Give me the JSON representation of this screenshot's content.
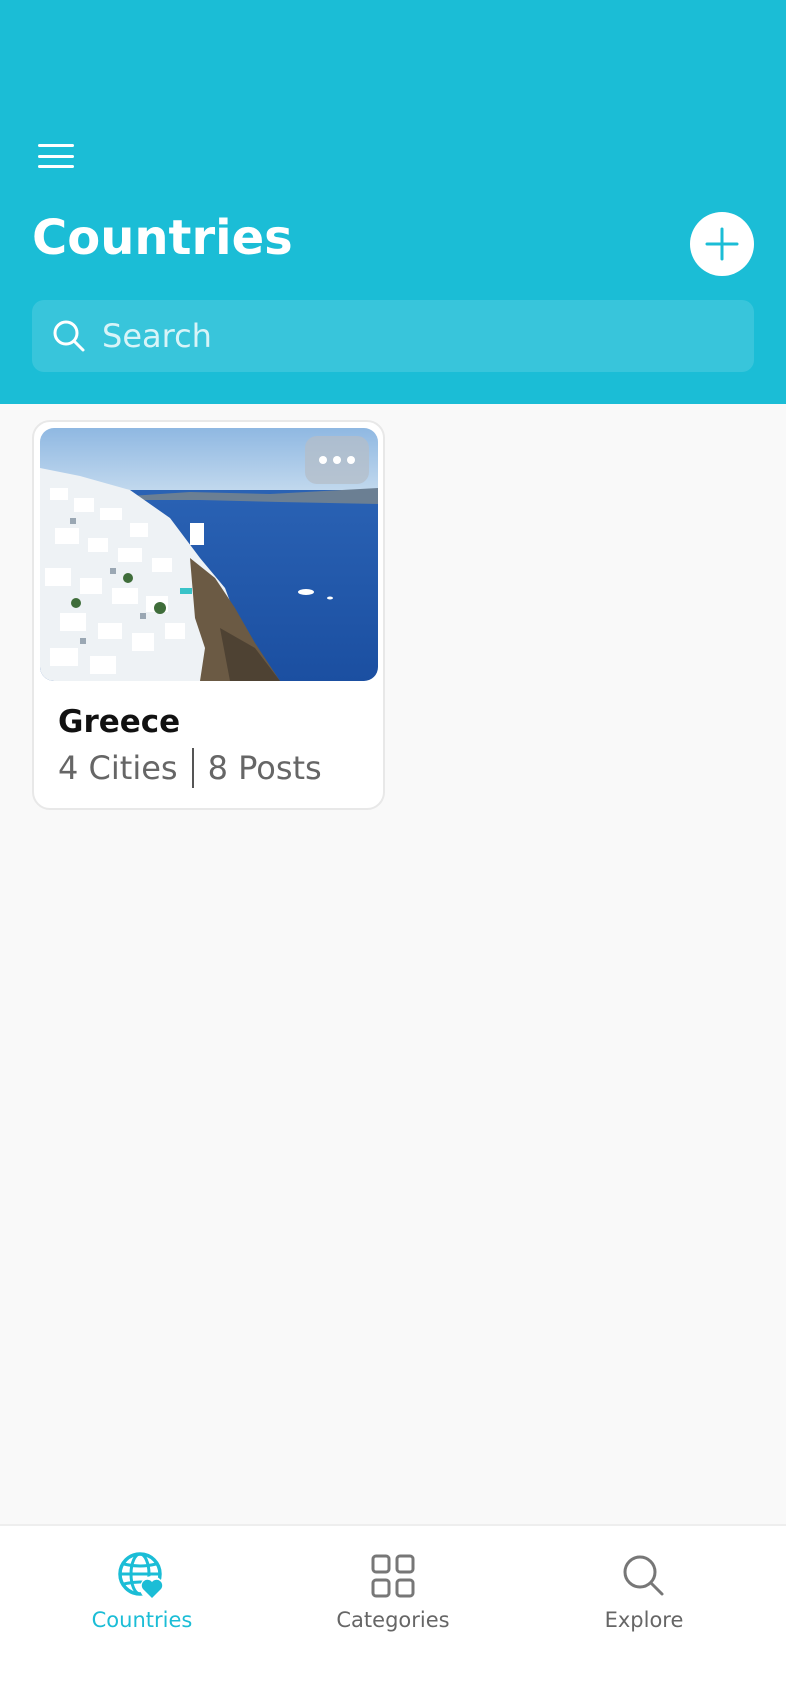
{
  "header": {
    "title": "Countries",
    "search_placeholder": "Search",
    "background_color": "#1bbdd6"
  },
  "countries": [
    {
      "name": "Greece",
      "cities": "4 Cities",
      "posts": "8 Posts",
      "image": "santorini-photo"
    }
  ],
  "bottom_nav": {
    "items": [
      {
        "label": "Countries",
        "icon": "globe-heart-icon",
        "active": true
      },
      {
        "label": "Categories",
        "icon": "grid-icon",
        "active": false
      },
      {
        "label": "Explore",
        "icon": "search-icon",
        "active": false
      }
    ],
    "active_color": "#1bbdd6"
  }
}
